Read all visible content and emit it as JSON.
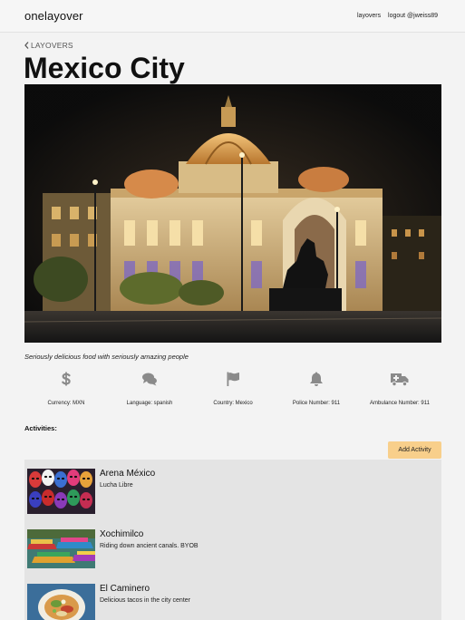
{
  "header": {
    "brand": "onelayover",
    "nav": {
      "layovers": "layovers",
      "logout": "logout @jweiss89"
    }
  },
  "breadcrumb": {
    "back_label": "LAYOVERS"
  },
  "city": {
    "name": "Mexico City",
    "tagline": "Seriously delicious food with seriously amazing people"
  },
  "facts": [
    {
      "icon": "dollar-icon",
      "label": "Currency: MXN"
    },
    {
      "icon": "chat-bubbles-icon",
      "label": "Language: spanish"
    },
    {
      "icon": "flag-icon",
      "label": "Country: Mexico"
    },
    {
      "icon": "bell-icon",
      "label": "Police Number: 911"
    },
    {
      "icon": "ambulance-icon",
      "label": "Ambulance Number: 911"
    }
  ],
  "activities": {
    "heading": "Activities:",
    "add_label": "Add Activity",
    "items": [
      {
        "name": "Arena México",
        "description": "Lucha Libre",
        "thumb": "lucha-masks"
      },
      {
        "name": "Xochimilco",
        "description": "Riding down ancient canals. BYOB",
        "thumb": "trajinera-boats"
      },
      {
        "name": "El Caminero",
        "description": "Delicious tacos in the city center",
        "thumb": "tacos-plate"
      }
    ]
  },
  "colors": {
    "accent_button": "#f8cf8b",
    "activity_bg": "#e4e4e4",
    "icon_gray": "#8a8a8a"
  }
}
